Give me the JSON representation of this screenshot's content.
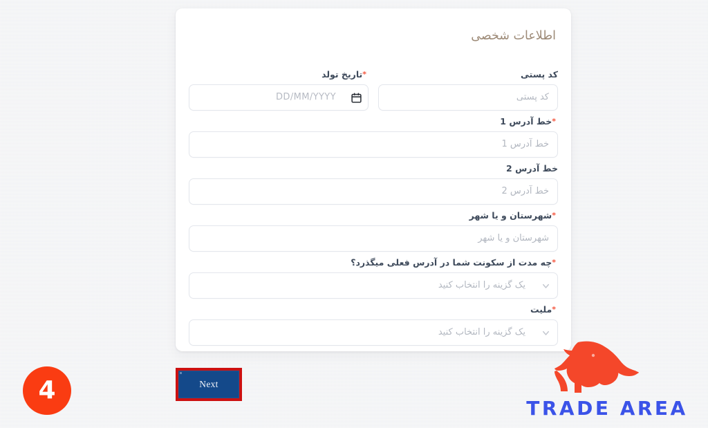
{
  "page": {
    "background_color": "#eeeef0",
    "card_background": "#ffffff"
  },
  "card": {
    "title": "اطلاعات شخصی",
    "title_color": "#9d8a77"
  },
  "form": {
    "required_marker": "*",
    "rows": [
      {
        "fields": [
          {
            "name": "postal-code",
            "label": "کد پستی",
            "required": false,
            "type": "text",
            "value": "",
            "placeholder": "کد پستی",
            "icon": ""
          },
          {
            "name": "birth-date",
            "label": "تاریخ تولد",
            "required": true,
            "type": "date",
            "value": "",
            "placeholder": "DD/MM/YYYY",
            "icon": "calendar-icon"
          }
        ]
      },
      {
        "fields": [
          {
            "name": "address-line-1",
            "label": "خط آدرس 1",
            "required": true,
            "type": "text",
            "value": "",
            "placeholder": "خط آدرس 1",
            "icon": ""
          }
        ]
      },
      {
        "fields": [
          {
            "name": "address-line-2",
            "label": "خط آدرس 2",
            "required": false,
            "type": "text",
            "value": "",
            "placeholder": "خط آدرس 2",
            "icon": ""
          }
        ]
      },
      {
        "fields": [
          {
            "name": "city-or-county",
            "label": "شهرستان و یا شهر",
            "required": true,
            "type": "text",
            "value": "",
            "placeholder": "شهرستان و یا شهر",
            "icon": ""
          }
        ]
      },
      {
        "fields": [
          {
            "name": "residence-duration",
            "label": "چه مدت از سکونت شما در آدرس فعلی میگذرد؟",
            "required": true,
            "type": "select",
            "value": "یک گزینه را انتخاب کنید",
            "placeholder": "یک گزینه را انتخاب کنید",
            "icon": "chevron-down-icon"
          }
        ]
      },
      {
        "fields": [
          {
            "name": "nationality",
            "label": "ملیت",
            "required": true,
            "type": "select",
            "value": "یک گزینه را انتخاب کنید",
            "placeholder": "یک گزینه را انتخاب کنید",
            "icon": "chevron-down-icon"
          }
        ]
      }
    ]
  },
  "actions": {
    "next_label": "Next",
    "next_button_color": "#14498a",
    "next_highlight_color": "#cc1111"
  },
  "annotations": {
    "step_number": "4",
    "step_badge_color": "#fa3c12"
  },
  "brand": {
    "name": "TRADE AREA",
    "mark": "bull-logo-icon",
    "mark_color": "#f4472a",
    "text_color": "#3b53e8"
  }
}
